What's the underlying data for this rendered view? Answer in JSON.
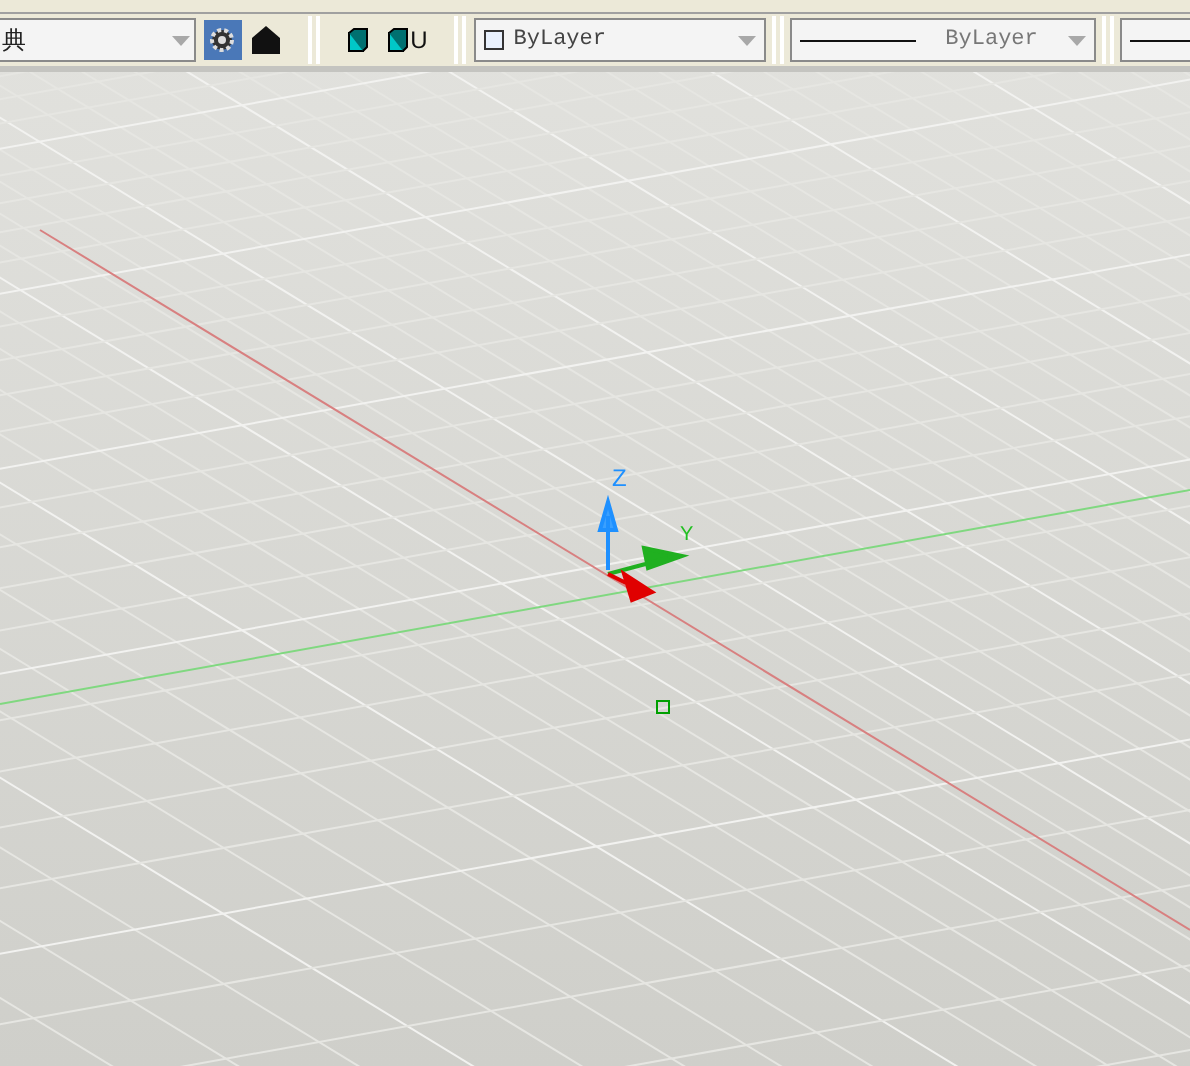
{
  "toolbar": {
    "style_dropdown": {
      "value": "典"
    },
    "ucs_button": {
      "label": "U"
    },
    "color_dropdown": {
      "value": "ByLayer"
    },
    "linetype_dropdown": {
      "value": "ByLayer"
    }
  },
  "viewport": {
    "ucs_labels": {
      "z": "Z",
      "y": "Y"
    }
  }
}
